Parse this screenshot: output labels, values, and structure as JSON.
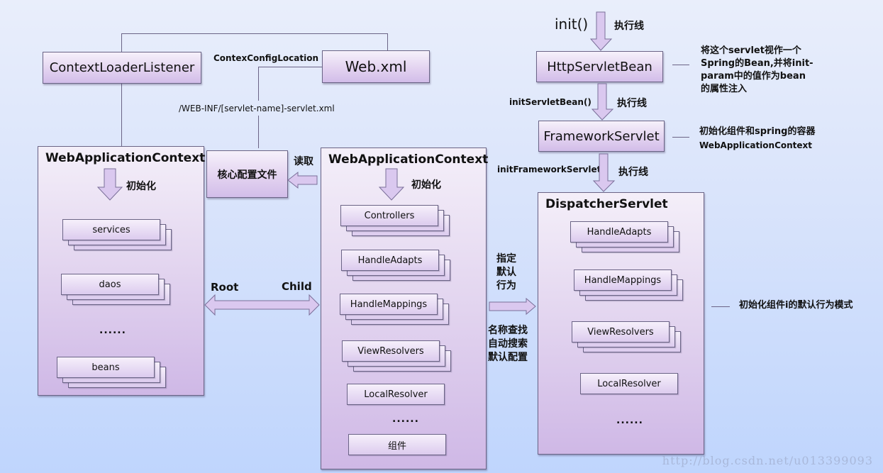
{
  "colors": {
    "background_top": "#e9eefb",
    "background_bottom": "#bfd5fd",
    "box_light": "#f6f1fb",
    "box_dark": "#d2bde9",
    "border": "#6b6486"
  },
  "top_left": {
    "context_loader_listener": "ContextLoaderListener",
    "web_xml": "Web.xml",
    "contex_config_location": "ContexConfigLocation",
    "servlet_xml_path": "/WEB-INF/[servlet-name]-servlet.xml"
  },
  "root_context": {
    "title": "WebApplicationContext",
    "init_label": "初始化",
    "items": [
      "services",
      "daos",
      "beans"
    ],
    "ellipsis": "......"
  },
  "core_config": {
    "label": "核心配置文件",
    "read_label": "读取"
  },
  "relation": {
    "root": "Root",
    "child": "Child"
  },
  "child_context": {
    "title": "WebApplicationContext",
    "init_label": "初始化",
    "stacked_items": [
      "Controllers",
      "HandleAdapts",
      "HandleMappings",
      "ViewResolvers"
    ],
    "single_items": [
      "LocalResolver"
    ],
    "ellipsis": "......",
    "component": "组件"
  },
  "middle_labels": {
    "specify_default": "指定\n默认\n行为",
    "lookup": "名称查找\n自动搜索\n默认配置"
  },
  "execution_chain": {
    "init": "init()",
    "exec_line": "执行线",
    "http_servlet_bean": "HttpServletBean",
    "init_servlet_bean": "initServletBean()",
    "framework_servlet": "FrameworkServlet",
    "init_framework_servlet": "initFrameworkServlet()"
  },
  "dispatcher": {
    "title": "DispatcherServlet",
    "stacked_items": [
      "HandleAdapts",
      "HandleMappings",
      "ViewResolvers"
    ],
    "single_items": [
      "LocalResolver"
    ],
    "ellipsis": "......"
  },
  "notes": {
    "http_servlet_bean": "将这个servlet视作一个Spring的Bean,并将init-param中的值作为bean的属性注入",
    "framework_servlet_1": "初始化组件和spring的容器",
    "framework_servlet_2": "WebApplicationContext",
    "dispatcher": "初始化组件i的默认行为模式"
  },
  "watermark": "http://blog.csdn.net/u013399093"
}
